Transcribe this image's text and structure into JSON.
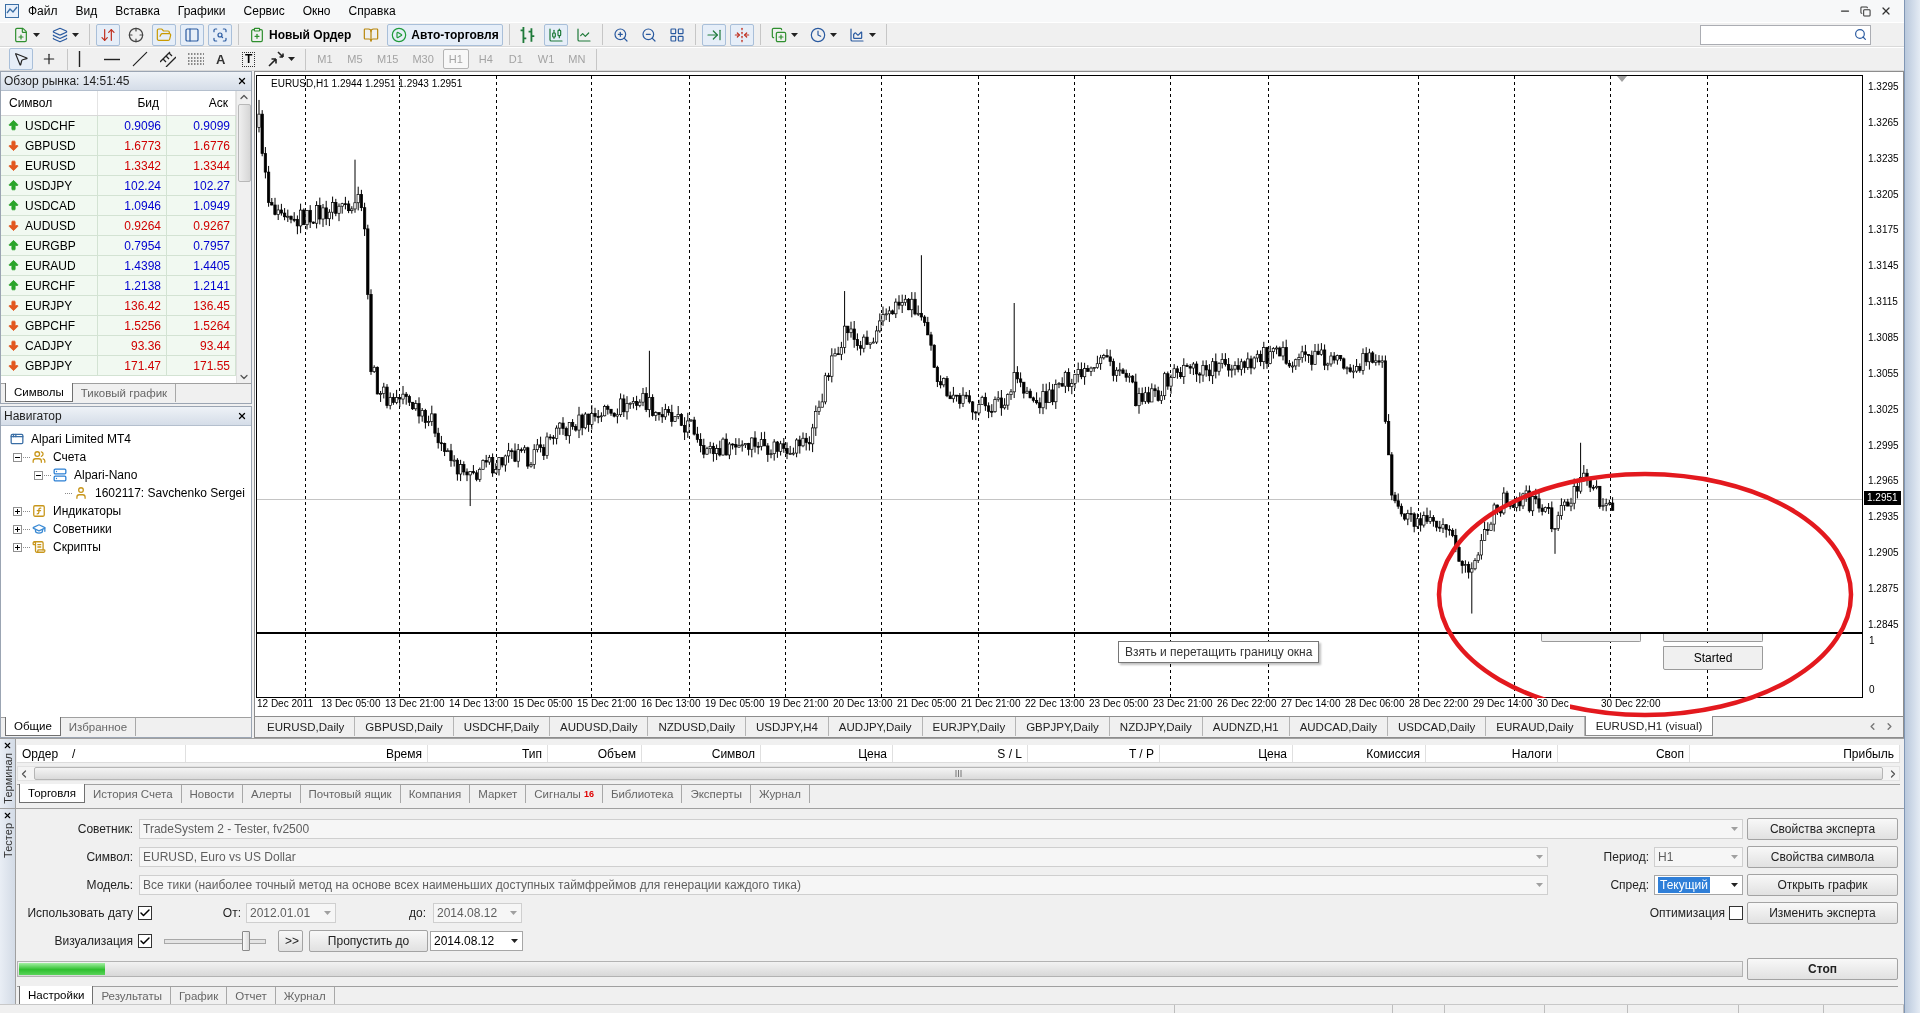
{
  "menu": [
    "Файл",
    "Вид",
    "Вставка",
    "Графики",
    "Сервис",
    "Окно",
    "Справка"
  ],
  "toolbar": {
    "groups": [
      [
        {
          "kind": "new-chart",
          "pressed": false
        },
        {
          "kind": "profiles",
          "pressed": false
        }
      ],
      [
        {
          "kind": "market-watch",
          "pressed": true
        },
        {
          "kind": "data-window",
          "pressed": false
        },
        {
          "kind": "navigator",
          "pressed": true
        },
        {
          "kind": "terminal",
          "pressed": true
        },
        {
          "kind": "tester",
          "pressed": true
        }
      ],
      [
        {
          "kind": "new-order",
          "label": "Новый Ордер",
          "pressed": false
        },
        {
          "kind": "editor",
          "pressed": false
        },
        {
          "kind": "auto-trading",
          "label": "Авто-торговля",
          "pressed": true
        }
      ],
      [
        {
          "kind": "bars",
          "pressed": false
        },
        {
          "kind": "candles",
          "pressed": true
        },
        {
          "kind": "line",
          "pressed": false
        }
      ],
      [
        {
          "kind": "zoom-in",
          "pressed": false
        },
        {
          "kind": "zoom-out",
          "pressed": false
        },
        {
          "kind": "tile",
          "pressed": false
        }
      ],
      [
        {
          "kind": "auto-scroll",
          "pressed": true
        },
        {
          "kind": "chart-shift",
          "pressed": true
        }
      ],
      [
        {
          "kind": "indicators",
          "pressed": false
        },
        {
          "kind": "periods",
          "pressed": false
        },
        {
          "kind": "templates",
          "pressed": false
        }
      ]
    ]
  },
  "drawing_toolbar": {
    "groups": [
      [
        {
          "kind": "cursor",
          "selected": true
        },
        {
          "kind": "crosshair",
          "selected": false
        }
      ],
      [
        {
          "kind": "vline",
          "selected": false
        },
        {
          "kind": "hline",
          "selected": false
        },
        {
          "kind": "trendline",
          "selected": false
        },
        {
          "kind": "channel",
          "selected": false
        },
        {
          "kind": "fibo",
          "selected": false
        },
        {
          "kind": "text",
          "label": "A",
          "selected": false
        },
        {
          "kind": "label",
          "label": "T",
          "selected": false
        },
        {
          "kind": "arrows",
          "selected": false
        }
      ]
    ],
    "timeframes": [
      {
        "label": "M1",
        "selected": false,
        "disabled": true
      },
      {
        "label": "M5",
        "selected": false,
        "disabled": true
      },
      {
        "label": "M15",
        "selected": false,
        "disabled": true
      },
      {
        "label": "M30",
        "selected": false,
        "disabled": true
      },
      {
        "label": "H1",
        "selected": true,
        "disabled": true
      },
      {
        "label": "H4",
        "selected": false,
        "disabled": true
      },
      {
        "label": "D1",
        "selected": false,
        "disabled": true
      },
      {
        "label": "W1",
        "selected": false,
        "disabled": true
      },
      {
        "label": "MN",
        "selected": false,
        "disabled": true
      }
    ]
  },
  "market_watch": {
    "title": "Обзор рынка: 14:51:45",
    "columns": [
      "Символ",
      "Бид",
      "Аск"
    ],
    "rows": [
      {
        "symbol": "USDCHF",
        "bid": "0.9096",
        "ask": "0.9099",
        "rising": true
      },
      {
        "symbol": "GBPUSD",
        "bid": "1.6773",
        "ask": "1.6776",
        "rising": false
      },
      {
        "symbol": "EURUSD",
        "bid": "1.3342",
        "ask": "1.3344",
        "rising": false
      },
      {
        "symbol": "USDJPY",
        "bid": "102.24",
        "ask": "102.27",
        "rising": true
      },
      {
        "symbol": "USDCAD",
        "bid": "1.0946",
        "ask": "1.0949",
        "rising": true
      },
      {
        "symbol": "AUDUSD",
        "bid": "0.9264",
        "ask": "0.9267",
        "rising": false
      },
      {
        "symbol": "EURGBP",
        "bid": "0.7954",
        "ask": "0.7957",
        "rising": true
      },
      {
        "symbol": "EURAUD",
        "bid": "1.4398",
        "ask": "1.4405",
        "rising": true
      },
      {
        "symbol": "EURCHF",
        "bid": "1.2138",
        "ask": "1.2141",
        "rising": true
      },
      {
        "symbol": "EURJPY",
        "bid": "136.42",
        "ask": "136.45",
        "rising": false
      },
      {
        "symbol": "GBPCHF",
        "bid": "1.5256",
        "ask": "1.5264",
        "rising": false
      },
      {
        "symbol": "CADJPY",
        "bid": "93.36",
        "ask": "93.44",
        "rising": false
      },
      {
        "symbol": "GBPJPY",
        "bid": "171.47",
        "ask": "171.55",
        "rising": false
      }
    ],
    "tabs": [
      {
        "label": "Символы",
        "selected": true
      },
      {
        "label": "Тиковый график",
        "selected": false
      }
    ]
  },
  "navigator": {
    "title": "Навигатор",
    "tree": [
      {
        "label": "Alpari Limited MT4",
        "kind": "terminal",
        "children": [
          {
            "label": "Счета",
            "kind": "accounts",
            "expanded": true,
            "children": [
              {
                "label": "Alpari-Nano",
                "kind": "server",
                "expanded": true,
                "children": [
                  {
                    "label": "1602117: Savchenko Sergei",
                    "kind": "account"
                  }
                ]
              }
            ]
          },
          {
            "label": "Индикаторы",
            "kind": "indicators",
            "expanded": false
          },
          {
            "label": "Советники",
            "kind": "experts",
            "expanded": false
          },
          {
            "label": "Скрипты",
            "kind": "scripts",
            "expanded": false
          }
        ]
      }
    ],
    "tabs": [
      {
        "label": "Общие",
        "selected": true
      },
      {
        "label": "Избранное",
        "selected": false
      }
    ]
  },
  "chart": {
    "header": "EURUSD,H1 1.2944 1.2951 1.2943 1.2951",
    "price_axis": [
      "1.3295",
      "1.3265",
      "1.3235",
      "1.3205",
      "1.3175",
      "1.3145",
      "1.3115",
      "1.3085",
      "1.3055",
      "1.3025",
      "1.2995",
      "1.2965",
      "1.2935",
      "1.2905",
      "1.2875",
      "1.2845"
    ],
    "current_price": "1.2951",
    "pane_axis": [
      "1",
      "0"
    ],
    "pane_buttons": [
      {
        "kind": "partial"
      },
      {
        "kind": "partial"
      },
      {
        "kind": "button",
        "label": "Started"
      }
    ],
    "tooltip": "Взять и перетащить границу окна",
    "time_axis": [
      "12 Dec 2011",
      "13 Dec 05:00",
      "13 Dec 21:00",
      "14 Dec 13:00",
      "15 Dec 05:00",
      "15 Dec 21:00",
      "16 Dec 13:00",
      "19 Dec 05:00",
      "19 Dec 21:00",
      "20 Dec 13:00",
      "21 Dec 05:00",
      "21 Dec 21:00",
      "22 Dec 13:00",
      "23 Dec 05:00",
      "23 Dec 21:00",
      "26 Dec 22:00",
      "27 Dec 14:00",
      "28 Dec 06:00",
      "28 Dec 22:00",
      "29 Dec 14:00",
      "30 Dec",
      "30 Dec 22:00"
    ],
    "tabs": [
      {
        "label": "EURUSD,Daily",
        "selected": false
      },
      {
        "label": "GBPUSD,Daily",
        "selected": false
      },
      {
        "label": "USDCHF,Daily",
        "selected": false
      },
      {
        "label": "AUDUSD,Daily",
        "selected": false
      },
      {
        "label": "NZDUSD,Daily",
        "selected": false
      },
      {
        "label": "USDJPY,H4",
        "selected": false
      },
      {
        "label": "AUDJPY,Daily",
        "selected": false
      },
      {
        "label": "EURJPY,Daily",
        "selected": false
      },
      {
        "label": "GBPJPY,Daily",
        "selected": false
      },
      {
        "label": "NZDJPY,Daily",
        "selected": false
      },
      {
        "label": "AUDNZD,H1",
        "selected": false
      },
      {
        "label": "AUDCAD,Daily",
        "selected": false
      },
      {
        "label": "USDCAD,Daily",
        "selected": false
      },
      {
        "label": "EURAUD,Daily",
        "selected": false
      },
      {
        "label": "EURUSD,H1 (visual)",
        "selected": true
      }
    ]
  },
  "terminal": {
    "side_label": "Терминал",
    "columns": [
      "Ордер",
      "Время",
      "Тип",
      "Объем",
      "Символ",
      "Цена",
      "S / L",
      "T / P",
      "Цена",
      "Комиссия",
      "Налоги",
      "Своп",
      "Прибыль"
    ],
    "sort_mark": "/",
    "tabs": [
      {
        "label": "Торговля",
        "selected": true
      },
      {
        "label": "История Счета",
        "selected": false
      },
      {
        "label": "Новости",
        "selected": false
      },
      {
        "label": "Алерты",
        "selected": false
      },
      {
        "label": "Почтовый ящик",
        "selected": false
      },
      {
        "label": "Компания",
        "selected": false
      },
      {
        "label": "Маркет",
        "selected": false
      },
      {
        "label": "Сигналы",
        "badge": "16",
        "selected": false
      },
      {
        "label": "Библиотека",
        "selected": false
      },
      {
        "label": "Эксперты",
        "selected": false
      },
      {
        "label": "Журнал",
        "selected": false
      }
    ]
  },
  "tester": {
    "side_label": "Тестер",
    "expert": {
      "label": "Советник:",
      "value": "TradeSystem 2 - Tester, fv2500",
      "disabled": true
    },
    "symbol": {
      "label": "Символ:",
      "value": "EURUSD, Euro vs US Dollar",
      "disabled": true
    },
    "model": {
      "label": "Модель:",
      "value": "Все тики (наиболее точный метод на основе всех наименьших доступных таймфреймов для генерации каждого тика)",
      "disabled": true
    },
    "period": {
      "label": "Период:",
      "value": "H1",
      "disabled": true
    },
    "spread": {
      "label": "Спред:",
      "value": "Текущий",
      "disabled": false,
      "highlighted": true
    },
    "use_date": {
      "label": "Использовать дату",
      "checked": true
    },
    "from": {
      "label": "От:",
      "value": "2012.01.01",
      "disabled": true
    },
    "to": {
      "label": "до:",
      "value": "2014.08.12",
      "disabled": true
    },
    "optimization": {
      "label": "Оптимизация",
      "checked": false
    },
    "visualization": {
      "label": "Визуализация",
      "checked": true
    },
    "speed": {
      "level": 0.81
    },
    "fast_forward": ">>",
    "skip_button": "Пропустить до",
    "skip_date": {
      "value": "2014.08.12",
      "disabled": false
    },
    "progress": {
      "level": 0.05
    },
    "buttons": [
      "Свойства эксперта",
      "Свойства символа",
      "Открыть график",
      "Изменить эксперта"
    ],
    "stop": "Стоп",
    "tabs": [
      {
        "label": "Настройки",
        "selected": true
      },
      {
        "label": "Результаты",
        "selected": false
      },
      {
        "label": "График",
        "selected": false
      },
      {
        "label": "Отчет",
        "selected": false
      },
      {
        "label": "Журнал",
        "selected": false
      }
    ]
  }
}
